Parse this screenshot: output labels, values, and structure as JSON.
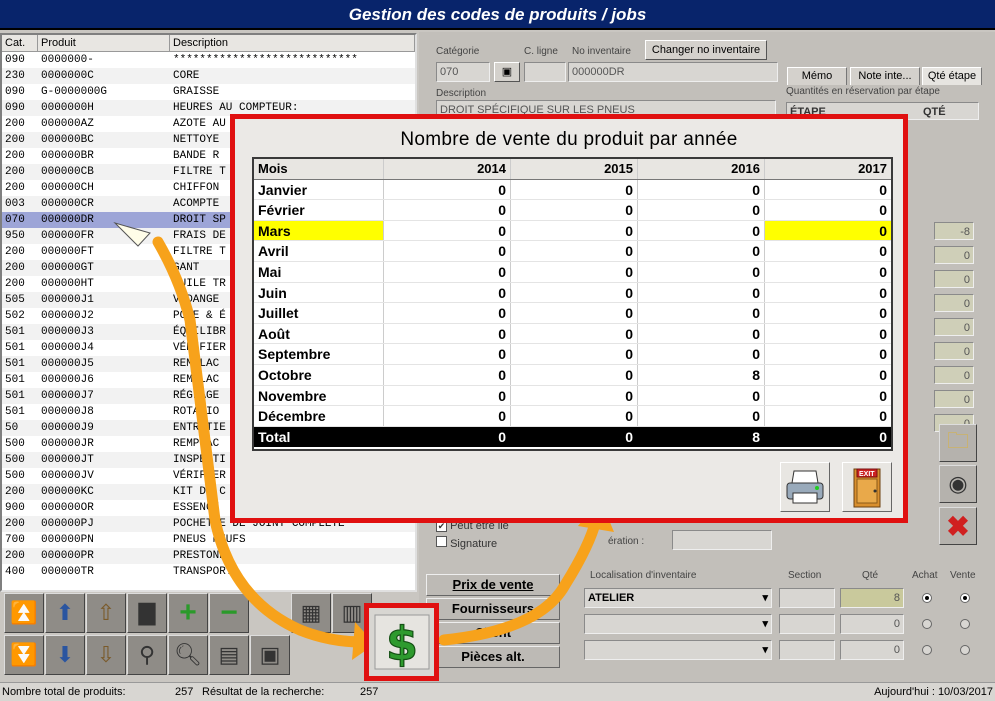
{
  "window": {
    "title": "Gestion des codes de produits / jobs"
  },
  "product_table": {
    "headers": [
      "Cat.",
      "Produit",
      "Description"
    ],
    "rows": [
      {
        "cat": "090",
        "code": "0000000-",
        "desc": "****************************"
      },
      {
        "cat": "230",
        "code": "0000000C",
        "desc": "CORE"
      },
      {
        "cat": "090",
        "code": "G-0000000G",
        "desc": "GRAISSE"
      },
      {
        "cat": "090",
        "code": "0000000H",
        "desc": "HEURES AU COMPTEUR:"
      },
      {
        "cat": "200",
        "code": "000000AZ",
        "desc": "AZOTE AU"
      },
      {
        "cat": "200",
        "code": "000000BC",
        "desc": "NETTOYE"
      },
      {
        "cat": "200",
        "code": "000000BR",
        "desc": "BANDE R"
      },
      {
        "cat": "200",
        "code": "000000CB",
        "desc": "FILTRE T"
      },
      {
        "cat": "200",
        "code": "000000CH",
        "desc": "CHIFFON"
      },
      {
        "cat": "003",
        "code": "000000CR",
        "desc": "ACOMPTE"
      },
      {
        "cat": "070",
        "code": "000000DR",
        "desc": "DROIT SP",
        "selected": true
      },
      {
        "cat": "950",
        "code": "000000FR",
        "desc": "FRAIS DE"
      },
      {
        "cat": "200",
        "code": "000000FT",
        "desc": "FILTRE T"
      },
      {
        "cat": "200",
        "code": "000000GT",
        "desc": "GANT"
      },
      {
        "cat": "200",
        "code": "000000HT",
        "desc": "HUILE TR"
      },
      {
        "cat": "505",
        "code": "000000J1",
        "desc": "VIDANGE"
      },
      {
        "cat": "502",
        "code": "000000J2",
        "desc": "POSE & É"
      },
      {
        "cat": "501",
        "code": "000000J3",
        "desc": "ÉQUILIBR"
      },
      {
        "cat": "501",
        "code": "000000J4",
        "desc": "VÉRIFIER"
      },
      {
        "cat": "501",
        "code": "000000J5",
        "desc": "REMPLAC"
      },
      {
        "cat": "501",
        "code": "000000J6",
        "desc": "REMPLAC"
      },
      {
        "cat": "501",
        "code": "000000J7",
        "desc": "RÉGLAGE"
      },
      {
        "cat": "501",
        "code": "000000J8",
        "desc": "ROTATIO"
      },
      {
        "cat": "50",
        "code": "000000J9",
        "desc": "ENTRETIE"
      },
      {
        "cat": "500",
        "code": "000000JR",
        "desc": "REMPLAC"
      },
      {
        "cat": "500",
        "code": "000000JT",
        "desc": "INSPECTI"
      },
      {
        "cat": "500",
        "code": "000000JV",
        "desc": "VÉRIFIER"
      },
      {
        "cat": "200",
        "code": "000000KC",
        "desc": "KIT DE C"
      },
      {
        "cat": "900",
        "code": "000000OR",
        "desc": "ESSENCE"
      },
      {
        "cat": "200",
        "code": "000000PJ",
        "desc": "POCHETTE DE JOINT COMPLETE"
      },
      {
        "cat": "700",
        "code": "000000PN",
        "desc": "PNEUS NEUFS"
      },
      {
        "cat": "200",
        "code": "000000PR",
        "desc": "PRESTONE"
      },
      {
        "cat": "400",
        "code": "000000TR",
        "desc": "TRANSPORT"
      }
    ]
  },
  "detail": {
    "categorie_label": "Catégorie",
    "categorie_value": "070",
    "cligne_label": "C. ligne",
    "noinv_label": "No inventaire",
    "noinv_value": "000000DR",
    "change_btn": "Changer no inventaire",
    "description_label": "Description",
    "description_value": "DROIT SPÉCIFIQUE SUR LES PNEUS",
    "tabs": [
      "Mémo",
      "Note inte...",
      "Qté étape"
    ],
    "reservation_label": "Quantités en réservation par étape",
    "etape_header": "ÉTAPE",
    "qte_header": "QTÉ",
    "side_values": [
      "-8",
      "0",
      "0",
      "0",
      "0",
      "0",
      "0",
      "0",
      "0"
    ],
    "peut_etre_lie": "Peut être lié",
    "signature": "Signature",
    "operation_label": "ération :"
  },
  "nav_buttons": [
    "Prix de vente",
    "Fournisseurs",
    "Client",
    "Pièces alt."
  ],
  "inventory": {
    "loc_label": "Localisation d'inventaire",
    "section_label": "Section",
    "qte_label": "Qté",
    "achat_label": "Achat",
    "vente_label": "Vente",
    "rows": [
      {
        "loc": "ATELIER",
        "qty": "8"
      },
      {
        "loc": "",
        "qty": "0"
      },
      {
        "loc": "",
        "qty": "0"
      }
    ]
  },
  "popup": {
    "title": "Nombre de vente du produit par année",
    "header": {
      "month": "Mois",
      "years": [
        "2014",
        "2015",
        "2016",
        "2017"
      ]
    },
    "highlighted_month": "Mars",
    "rows": [
      {
        "month": "Janvier",
        "values": [
          "0",
          "0",
          "0",
          "0"
        ]
      },
      {
        "month": "Février",
        "values": [
          "0",
          "0",
          "0",
          "0"
        ]
      },
      {
        "month": "Mars",
        "values": [
          "0",
          "0",
          "0",
          "0"
        ]
      },
      {
        "month": "Avril",
        "values": [
          "0",
          "0",
          "0",
          "0"
        ]
      },
      {
        "month": "Mai",
        "values": [
          "0",
          "0",
          "0",
          "0"
        ]
      },
      {
        "month": "Juin",
        "values": [
          "0",
          "0",
          "0",
          "0"
        ]
      },
      {
        "month": "Juillet",
        "values": [
          "0",
          "0",
          "0",
          "0"
        ]
      },
      {
        "month": "Août",
        "values": [
          "0",
          "0",
          "0",
          "0"
        ]
      },
      {
        "month": "Septembre",
        "values": [
          "0",
          "0",
          "0",
          "0"
        ]
      },
      {
        "month": "Octobre",
        "values": [
          "0",
          "0",
          "8",
          "0"
        ]
      },
      {
        "month": "Novembre",
        "values": [
          "0",
          "0",
          "0",
          "0"
        ]
      },
      {
        "month": "Décembre",
        "values": [
          "0",
          "0",
          "0",
          "0"
        ]
      }
    ],
    "total": {
      "month": "Total",
      "values": [
        "0",
        "0",
        "8",
        "0"
      ]
    },
    "exit_label": "EXIT"
  },
  "status": {
    "total_label": "Nombre total de produits:",
    "total_value": "257",
    "search_label": "Résultat de la recherche:",
    "search_value": "257",
    "today": "Aujourd'hui : 10/03/2017"
  },
  "colors": {
    "highlight": "#ffff00",
    "callout_border": "#e01010",
    "arrow": "#f7a21b",
    "title_bar": "#08246b",
    "selected_row": "#9da5d7"
  },
  "icons": [
    "folder-icon",
    "camera-icon",
    "delete-x-icon",
    "printer-icon",
    "exit-door-icon",
    "dollar-icon"
  ]
}
